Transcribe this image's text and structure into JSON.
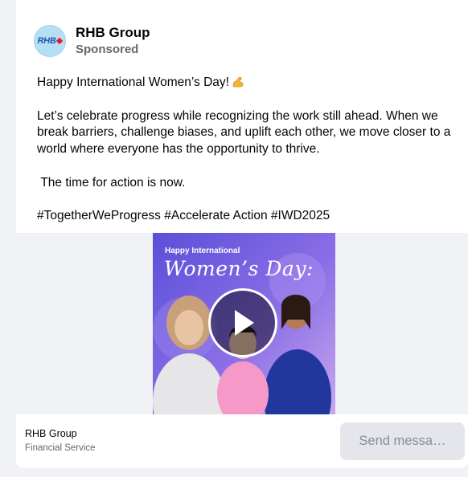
{
  "post": {
    "page_name": "RHB Group",
    "sponsored_label": "Sponsored",
    "avatar_logo_text": "RHB",
    "lines": [
      "Happy International Women’s Day!",
      "Let’s celebrate progress while recognizing the work still ahead. When we",
      "break barriers, challenge biases, and uplift each other, we move closer to a",
      "world where everyone has the opportunity to thrive.",
      " The time for action is now.",
      "#TogetherWeProgress #Accelerate Action #IWD2025"
    ],
    "emoji": "flexed-biceps-icon"
  },
  "media": {
    "title_small": "Happy International",
    "title_big": "Women’s Day:",
    "play_icon": "play-icon"
  },
  "footer": {
    "name": "RHB Group",
    "category": "Financial Service",
    "send_button": "Send messa…"
  },
  "colors": {
    "brand_blue": "#1b57a8",
    "brand_red": "#e21e26",
    "avatar_bg": "#b6dff5",
    "secondary_text": "#65676b",
    "button_bg": "#e4e6eb"
  }
}
